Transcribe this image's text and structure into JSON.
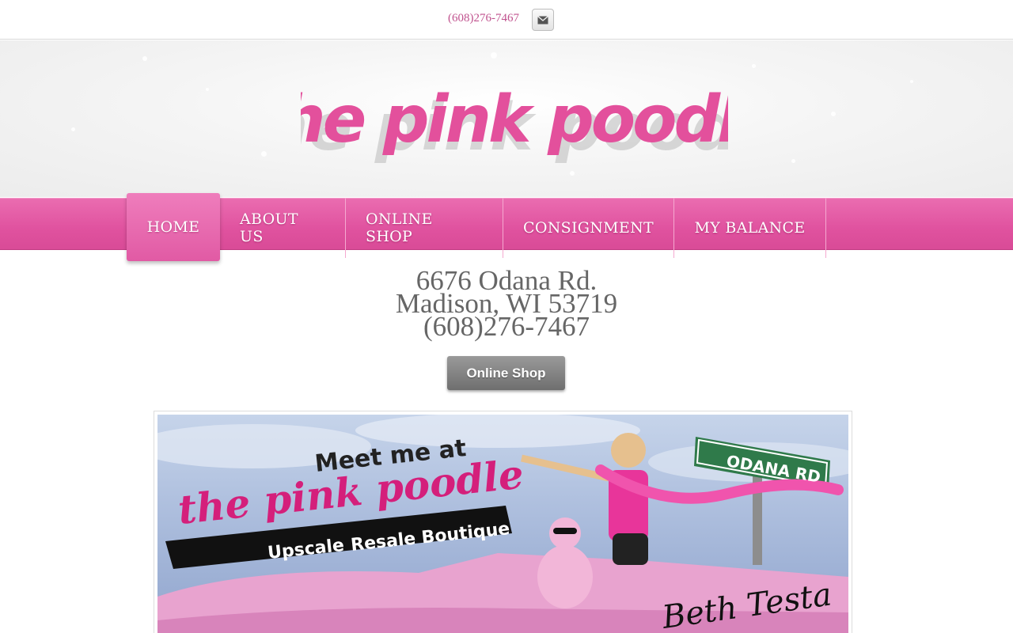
{
  "topbar": {
    "phone": "(608)276-7467"
  },
  "header": {
    "logo_text": "the pink poodle"
  },
  "nav": {
    "items": [
      {
        "label": "HOME",
        "active": true
      },
      {
        "label": "ABOUT US"
      },
      {
        "label": "ONLINE SHOP"
      },
      {
        "label": "CONSIGNMENT"
      },
      {
        "label": "MY BALANCE"
      }
    ]
  },
  "address": {
    "line1": "6676 Odana Rd.",
    "line2": "Madison, WI 53719",
    "line3": "(608)276-7467"
  },
  "button": {
    "label": "Online Shop"
  },
  "banner": {
    "meet": "Meet me at",
    "brand": "the pink poodle",
    "tag1": "Upscale",
    "tag2": "Resale Boutique",
    "street_sign": "ODANA RD",
    "signature": "Beth Testa"
  },
  "colors": {
    "brand_pink": "#e0529f",
    "text_gray": "#666666"
  }
}
